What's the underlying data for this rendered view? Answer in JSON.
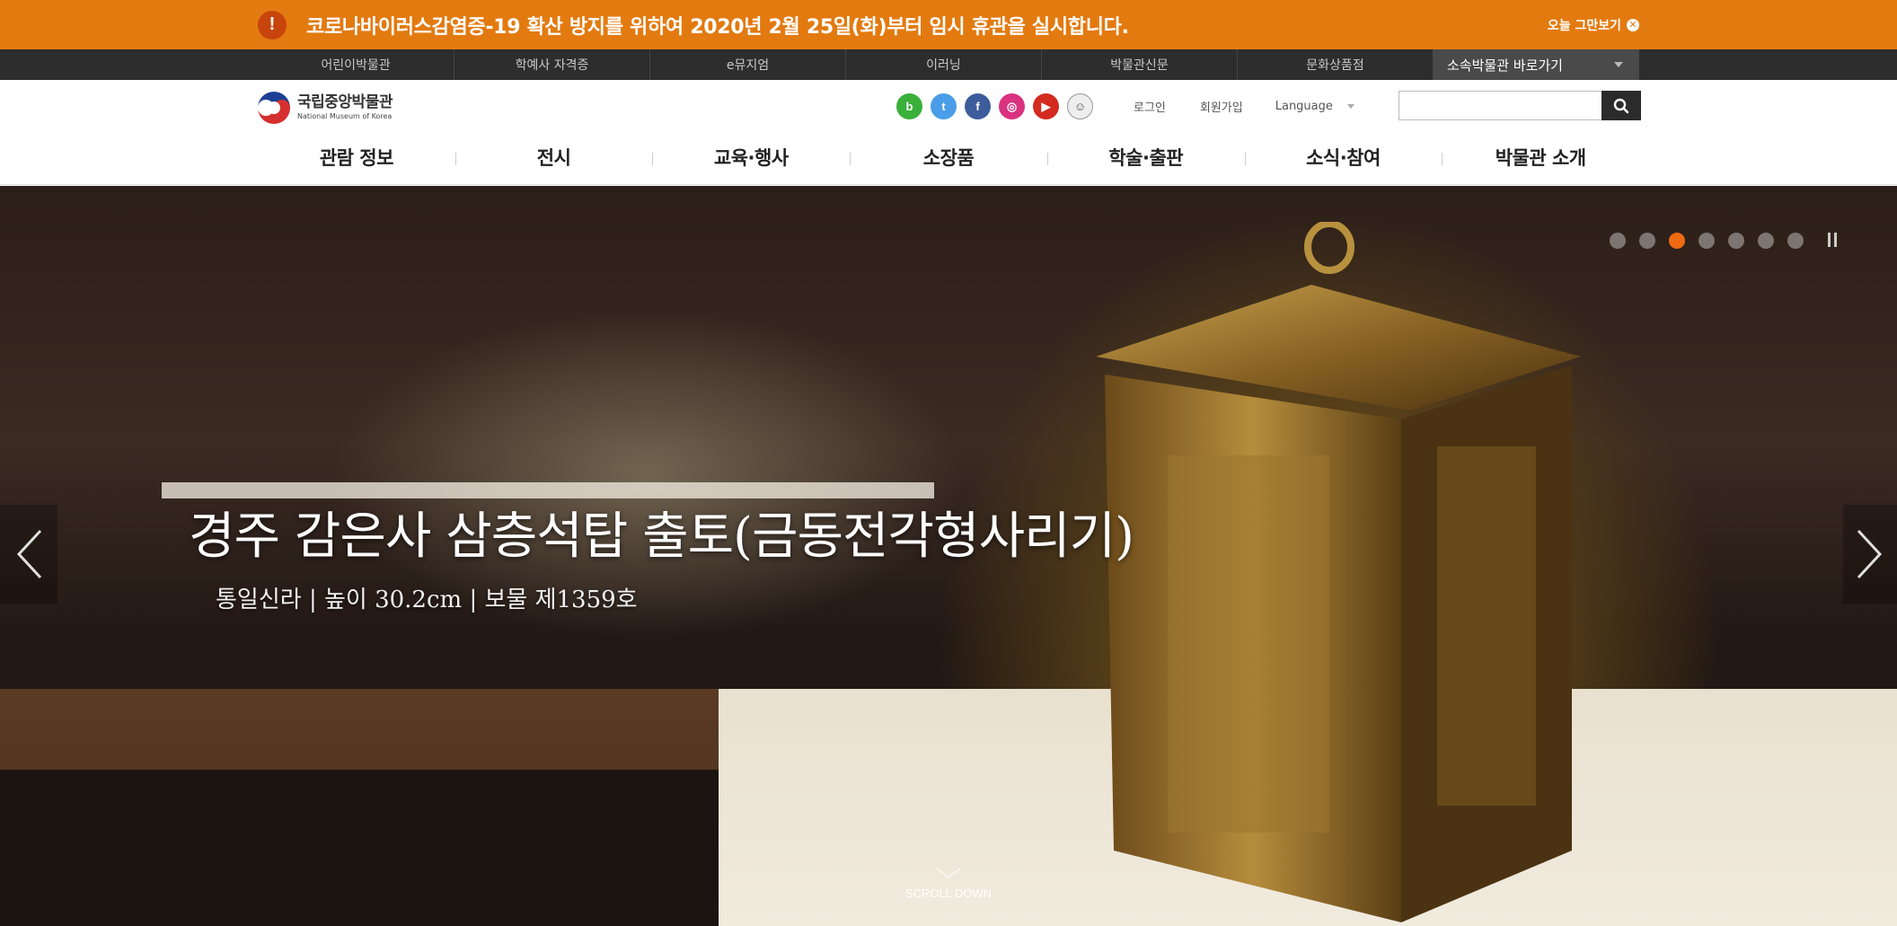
{
  "notice": {
    "alert_icon": "!",
    "text": "코로나바이러스감염증-19 확산 방지를 위하여 2020년 2월 25일(화)부터 임시 휴관을 실시합니다.",
    "close_label": "오늘 그만보기",
    "close_icon": "✕",
    "bg_color": "#e37a0f"
  },
  "utility": {
    "items": [
      {
        "label": "어린이박물관"
      },
      {
        "label": "학예사 자격증"
      },
      {
        "label": "e뮤지엄"
      },
      {
        "label": "이러닝"
      },
      {
        "label": "박물관신문"
      },
      {
        "label": "문화상품점"
      }
    ],
    "family_label": "소속박물관 바로가기"
  },
  "header": {
    "logo": {
      "ko": "국립중앙박물관",
      "en": "National Museum of Korea"
    },
    "social": [
      {
        "name": "blog-icon",
        "glyph": "b"
      },
      {
        "name": "twitter-icon",
        "glyph": "t"
      },
      {
        "name": "facebook-icon",
        "glyph": "f"
      },
      {
        "name": "instagram-icon",
        "glyph": "◎"
      },
      {
        "name": "youtube-icon",
        "glyph": "▶"
      },
      {
        "name": "museum-mascot-icon",
        "glyph": "☺"
      }
    ],
    "login": "로그인",
    "join": "회원가입",
    "language": "Language",
    "search_placeholder": ""
  },
  "gnb": {
    "items": [
      {
        "label": "관람 정보"
      },
      {
        "label": "전시"
      },
      {
        "label": "교육·행사"
      },
      {
        "label": "소장품"
      },
      {
        "label": "학술·출판"
      },
      {
        "label": "소식·참여"
      },
      {
        "label": "박물관 소개"
      }
    ]
  },
  "hero": {
    "title": "경주 감은사 삼층석탑 출토(금동전각형사리기)",
    "subtitle": "통일신라 | 높이 30.2cm | 보물 제1359호",
    "slide_count": 7,
    "active_slide": 3,
    "accent_color": "#ef6a12",
    "scroll_label": "SCROLL DOWN"
  }
}
